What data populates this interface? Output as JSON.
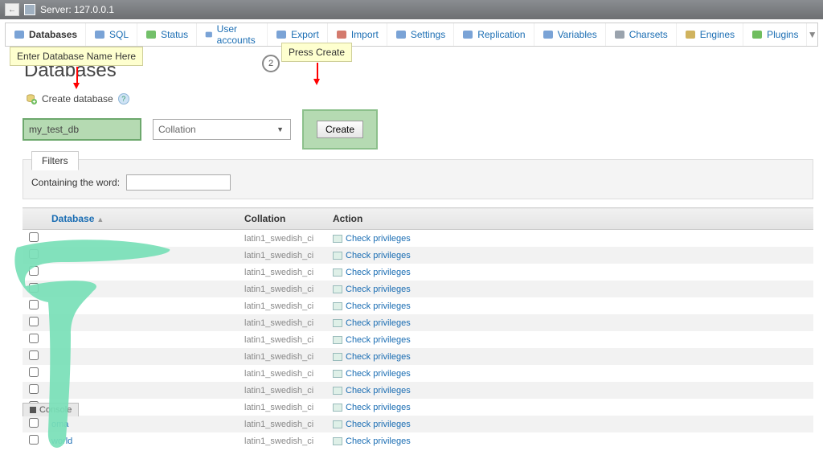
{
  "topbar": {
    "server_label": "Server: 127.0.0.1"
  },
  "tabs": [
    {
      "id": "databases",
      "label": "Databases",
      "icon_color": "#7aa3d6",
      "active": true
    },
    {
      "id": "sql",
      "label": "SQL",
      "icon_color": "#7aa3d6"
    },
    {
      "id": "status",
      "label": "Status",
      "icon_color": "#73c06a"
    },
    {
      "id": "user-accounts",
      "label": "User accounts",
      "icon_color": "#7aa3d6"
    },
    {
      "id": "export",
      "label": "Export",
      "icon_color": "#7aa3d6"
    },
    {
      "id": "import",
      "label": "Import",
      "icon_color": "#d47a6d"
    },
    {
      "id": "settings",
      "label": "Settings",
      "icon_color": "#7aa3d6"
    },
    {
      "id": "replication",
      "label": "Replication",
      "icon_color": "#7aa3d6"
    },
    {
      "id": "variables",
      "label": "Variables",
      "icon_color": "#7aa3d6"
    },
    {
      "id": "charsets",
      "label": "Charsets",
      "icon_color": "#9aa3ad"
    },
    {
      "id": "engines",
      "label": "Engines",
      "icon_color": "#d0b35e"
    },
    {
      "id": "plugins",
      "label": "Plugins",
      "icon_color": "#6fbd5e"
    }
  ],
  "page": {
    "title": "Databases",
    "create_label": "Create database",
    "create_button": "Create",
    "input_value": "my_test_db",
    "collation_placeholder": "Collation",
    "filters_label": "Filters",
    "containing_label": "Containing the word:",
    "containing_value": ""
  },
  "annotations": {
    "tooltip_name": "Enter Database Name Here",
    "tooltip_create": "Press Create",
    "step_number": "2"
  },
  "table": {
    "headers": {
      "database": "Database",
      "collation": "Collation",
      "action": "Action"
    },
    "action_text": "Check privileges",
    "rows": [
      {
        "name": "",
        "collation": "latin1_swedish_ci"
      },
      {
        "name": "",
        "collation": "latin1_swedish_ci"
      },
      {
        "name": "",
        "collation": "latin1_swedish_ci"
      },
      {
        "name": "",
        "collation": "latin1_swedish_ci"
      },
      {
        "name": "",
        "collation": "latin1_swedish_ci"
      },
      {
        "name": "",
        "collation": "latin1_swedish_ci"
      },
      {
        "name": "",
        "collation": "latin1_swedish_ci"
      },
      {
        "name": "",
        "collation": "latin1_swedish_ci"
      },
      {
        "name": "",
        "collation": "latin1_swedish_ci"
      },
      {
        "name": "",
        "collation": "latin1_swedish_ci"
      },
      {
        "name": "",
        "collation": "latin1_swedish_ci"
      },
      {
        "name": "oma",
        "collation": "latin1_swedish_ci"
      },
      {
        "name": "world",
        "collation": "latin1_swedish_ci"
      }
    ]
  },
  "console": {
    "label": "Console"
  }
}
